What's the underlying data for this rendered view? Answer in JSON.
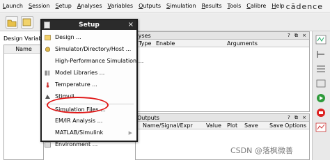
{
  "menubar": {
    "items": [
      "Launch",
      "Session",
      "Setup",
      "Analyses",
      "Variables",
      "Outputs",
      "Simulation",
      "Results",
      "Tools",
      "Calibre",
      "Help"
    ],
    "brand": "cādence"
  },
  "left_panel": {
    "label": "Design Variabl",
    "column": "Name"
  },
  "analyses_pane": {
    "title": "Analyses",
    "col_type": "Type",
    "col_enable": "Enable",
    "col_args": "Arguments",
    "controls": "? ⧉ ×"
  },
  "outputs_pane": {
    "title": "Outputs",
    "col_name": "Name/Signal/Expr",
    "col_value": "Value",
    "col_plot": "Plot",
    "col_save": "Save",
    "col_save_opts": "Save Options",
    "controls": "? ⧉ ×"
  },
  "dialog": {
    "title": "Setup",
    "close": "×",
    "items": [
      {
        "label": "Design ...",
        "icon": "design-icon"
      },
      {
        "label": "Simulator/Directory/Host ...",
        "icon": "simulator-icon"
      },
      {
        "label": "High-Performance Simulation ...",
        "icon": "none"
      },
      {
        "label": "Model Libraries ...",
        "icon": "library-icon"
      },
      {
        "label": "Temperature ...",
        "icon": "thermometer-icon"
      },
      {
        "label": "Stimuli ...",
        "icon": "stimuli-icon"
      },
      {
        "label": "Simulation Files ...",
        "icon": "none"
      },
      {
        "label": "EM/IR Analysis ...",
        "icon": "none"
      },
      {
        "label": "MATLAB/Simulink",
        "icon": "none",
        "submenu": true
      },
      {
        "label": "Environment ...",
        "icon": "environment-icon"
      }
    ]
  },
  "watermark": "CSDN @落枫微善",
  "colors": {
    "dialog_title": "#2b2b2b",
    "highlight_ring": "#e01818"
  }
}
